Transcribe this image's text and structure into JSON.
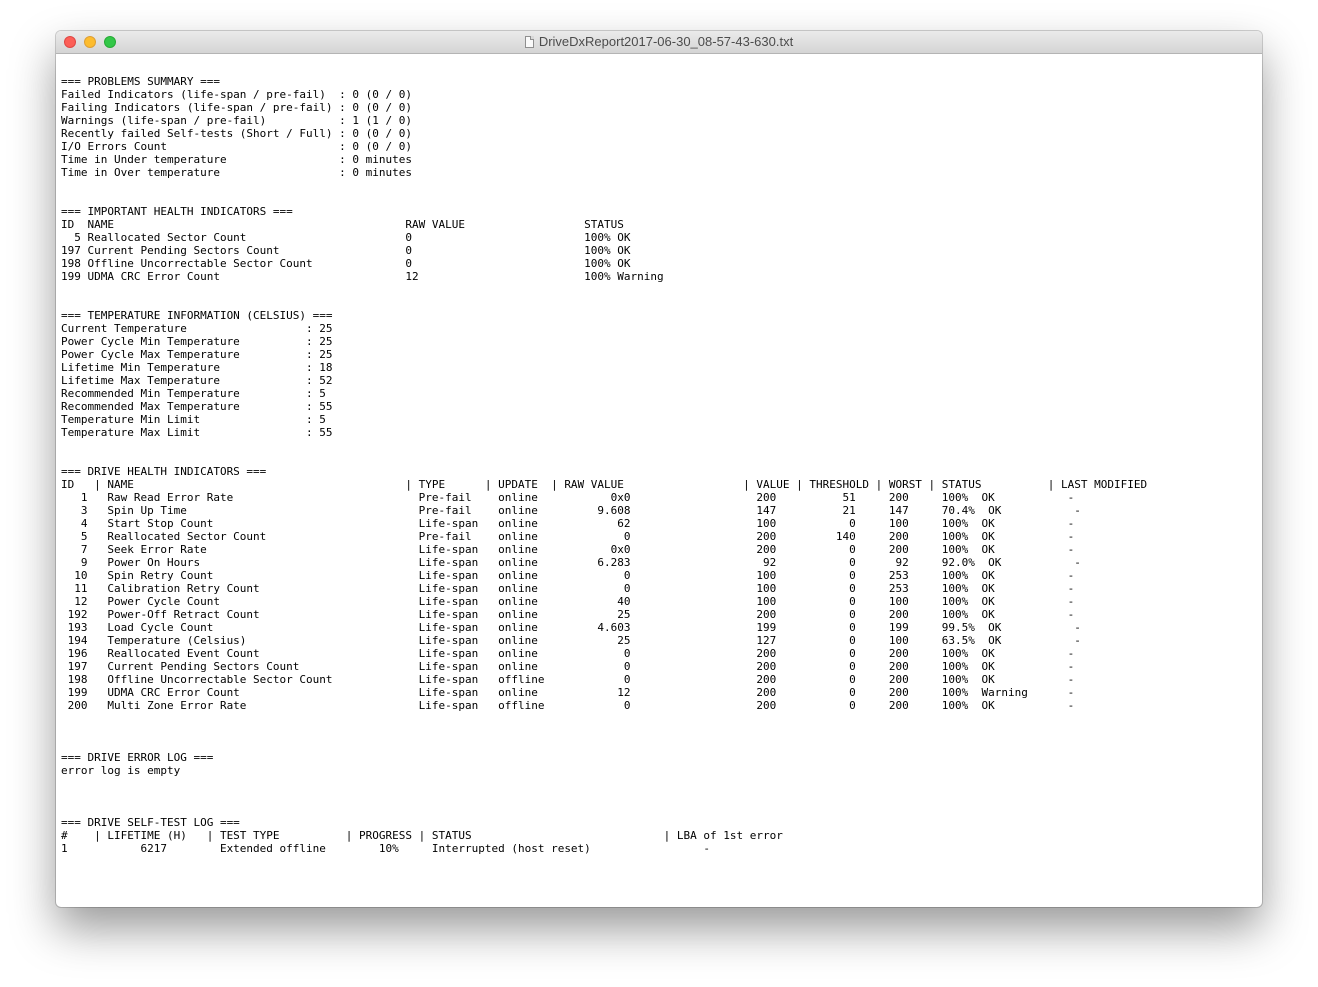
{
  "window": {
    "title": "DriveDxReport2017-06-30_08-57-43-630.txt"
  },
  "colors": {
    "close": "#fc5f57",
    "minimize": "#fdbc2e",
    "zoom": "#33c748",
    "text": "#000000"
  },
  "icons": {
    "document": "document-icon"
  },
  "report": {
    "lines": [
      "=== PROBLEMS SUMMARY ===",
      "Failed Indicators (life-span / pre-fail)  : 0 (0 / 0)",
      "Failing Indicators (life-span / pre-fail) : 0 (0 / 0)",
      "Warnings (life-span / pre-fail)           : 1 (1 / 0)",
      "Recently failed Self-tests (Short / Full) : 0 (0 / 0)",
      "I/O Errors Count                          : 0 (0 / 0)",
      "Time in Under temperature                 : 0 minutes",
      "Time in Over temperature                  : 0 minutes",
      "",
      "",
      "=== IMPORTANT HEALTH INDICATORS ===",
      "ID  NAME                                            RAW VALUE                  STATUS",
      "  5 Reallocated Sector Count                        0                          100% OK",
      "197 Current Pending Sectors Count                   0                          100% OK",
      "198 Offline Uncorrectable Sector Count              0                          100% OK",
      "199 UDMA CRC Error Count                            12                         100% Warning",
      "",
      "",
      "=== TEMPERATURE INFORMATION (CELSIUS) ===",
      "Current Temperature                  : 25",
      "Power Cycle Min Temperature          : 25",
      "Power Cycle Max Temperature          : 25",
      "Lifetime Min Temperature             : 18",
      "Lifetime Max Temperature             : 52",
      "Recommended Min Temperature          : 5",
      "Recommended Max Temperature          : 55",
      "Temperature Min Limit                : 5",
      "Temperature Max Limit                : 55",
      "",
      "",
      "=== DRIVE HEALTH INDICATORS ===",
      "ID   | NAME                                         | TYPE      | UPDATE  | RAW VALUE                  | VALUE | THRESHOLD | WORST | STATUS          | LAST MODIFIED",
      "   1   Raw Read Error Rate                            Pre-fail    online           0x0                   200          51     200     100%  OK           -",
      "   3   Spin Up Time                                   Pre-fail    online         9.608                   147          21     147     70.4%  OK           -",
      "   4   Start Stop Count                               Life-span   online            62                   100           0     100     100%  OK           -",
      "   5   Reallocated Sector Count                       Pre-fail    online             0                   200         140     200     100%  OK           -",
      "   7   Seek Error Rate                                Life-span   online           0x0                   200           0     200     100%  OK           -",
      "   9   Power On Hours                                 Life-span   online         6.283                    92           0      92     92.0%  OK           -",
      "  10   Spin Retry Count                               Life-span   online             0                   100           0     253     100%  OK           -",
      "  11   Calibration Retry Count                        Life-span   online             0                   100           0     253     100%  OK           -",
      "  12   Power Cycle Count                              Life-span   online            40                   100           0     100     100%  OK           -",
      " 192   Power-Off Retract Count                        Life-span   online            25                   200           0     200     100%  OK           -",
      " 193   Load Cycle Count                               Life-span   online         4.603                   199           0     199     99.5%  OK           -",
      " 194   Temperature (Celsius)                          Life-span   online            25                   127           0     100     63.5%  OK           -",
      " 196   Reallocated Event Count                        Life-span   online             0                   200           0     200     100%  OK           -",
      " 197   Current Pending Sectors Count                  Life-span   online             0                   200           0     200     100%  OK           -",
      " 198   Offline Uncorrectable Sector Count             Life-span   offline            0                   200           0     200     100%  OK           -",
      " 199   UDMA CRC Error Count                           Life-span   online            12                   200           0     200     100%  Warning      -",
      " 200   Multi Zone Error Rate                          Life-span   offline            0                   200           0     200     100%  OK           -",
      "",
      "",
      "",
      "=== DRIVE ERROR LOG ===",
      "error log is empty",
      "",
      "",
      "",
      "=== DRIVE SELF-TEST LOG ===",
      "#    | LIFETIME (H)   | TEST TYPE          | PROGRESS | STATUS                             | LBA of 1st error",
      "1           6217        Extended offline        10%     Interrupted (host reset)                 -"
    ]
  }
}
